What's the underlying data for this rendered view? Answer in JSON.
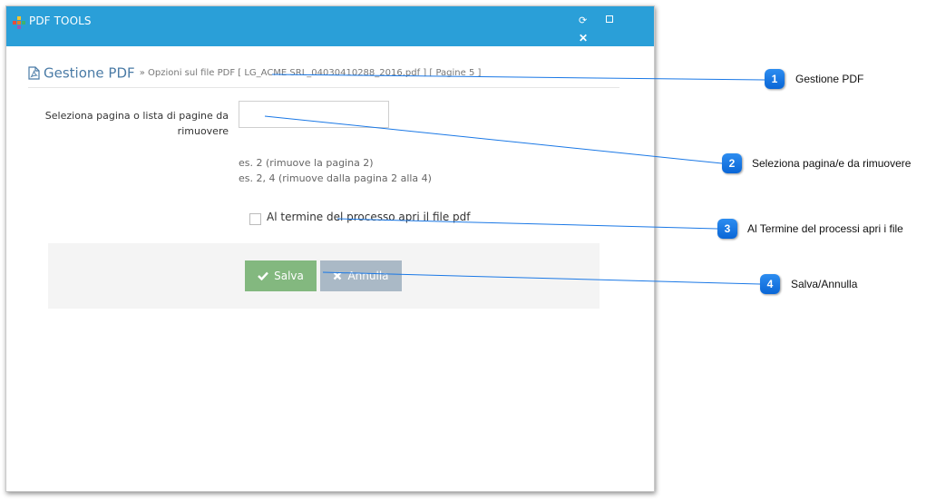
{
  "window": {
    "title": "PDF TOOLS",
    "refresh_glyph": "⟳",
    "close_glyph": "✕"
  },
  "header": {
    "title": "Gestione PDF",
    "subtitle": "» Opzioni sul file PDF [ LG_ACME SRL_04030410288_2016.pdf ] [ Pagine 5 ]"
  },
  "form": {
    "pages_label": "Seleziona pagina o lista di pagine da rimuovere",
    "pages_value": "",
    "help_line1": "es. 2 (rimuove la pagina 2)",
    "help_line2": "es. 2, 4 (rimuove dalla pagina 2 alla 4)",
    "open_checkbox_label": "Al termine del processo apri il file pdf",
    "open_checkbox_checked": false
  },
  "buttons": {
    "save": "Salva",
    "cancel": "Annulla"
  },
  "callouts": [
    {
      "number": "1",
      "text": "Gestione PDF"
    },
    {
      "number": "2",
      "text": "Seleziona pagina/e da rimuovere"
    },
    {
      "number": "3",
      "text": "Al Termine del processi apri i file"
    },
    {
      "number": "4",
      "text": "Salva/Annulla"
    }
  ],
  "colors": {
    "titlebar": "#2a9fd8",
    "save": "#83b87f",
    "cancel": "#aab9c6",
    "callout": "#1a78e6"
  }
}
